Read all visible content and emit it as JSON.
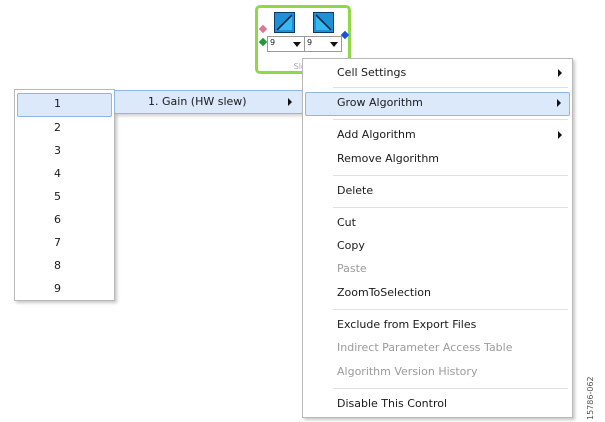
{
  "block": {
    "label": "Slew",
    "select_left": "9",
    "select_right": "9",
    "icons": [
      "slew-gain-tile-icon",
      "slew-gain-tile-icon"
    ]
  },
  "number_list": {
    "items": [
      "1",
      "2",
      "3",
      "4",
      "5",
      "6",
      "7",
      "8",
      "9"
    ],
    "selected": "1"
  },
  "algorithm_submenu": {
    "item": "1. Gain (HW slew)"
  },
  "context_menu": {
    "cell_settings": "Cell Settings",
    "grow_algorithm": "Grow Algorithm",
    "add_algorithm": "Add Algorithm",
    "remove_algorithm": "Remove Algorithm",
    "delete": "Delete",
    "cut": "Cut",
    "copy": "Copy",
    "paste": "Paste",
    "zoom_to_selection": "ZoomToSelection",
    "exclude_from_export": "Exclude from Export Files",
    "indirect_parameter": "Indirect Parameter Access Table",
    "algorithm_version_history": "Algorithm Version History",
    "disable_control": "Disable This Control"
  },
  "figure_id": "15786-062",
  "colors": {
    "block_border": "#8ed84a",
    "highlight_bg": "#dbe9fb",
    "highlight_border": "#8fb6e6",
    "disabled_text": "#9b9b9b"
  }
}
